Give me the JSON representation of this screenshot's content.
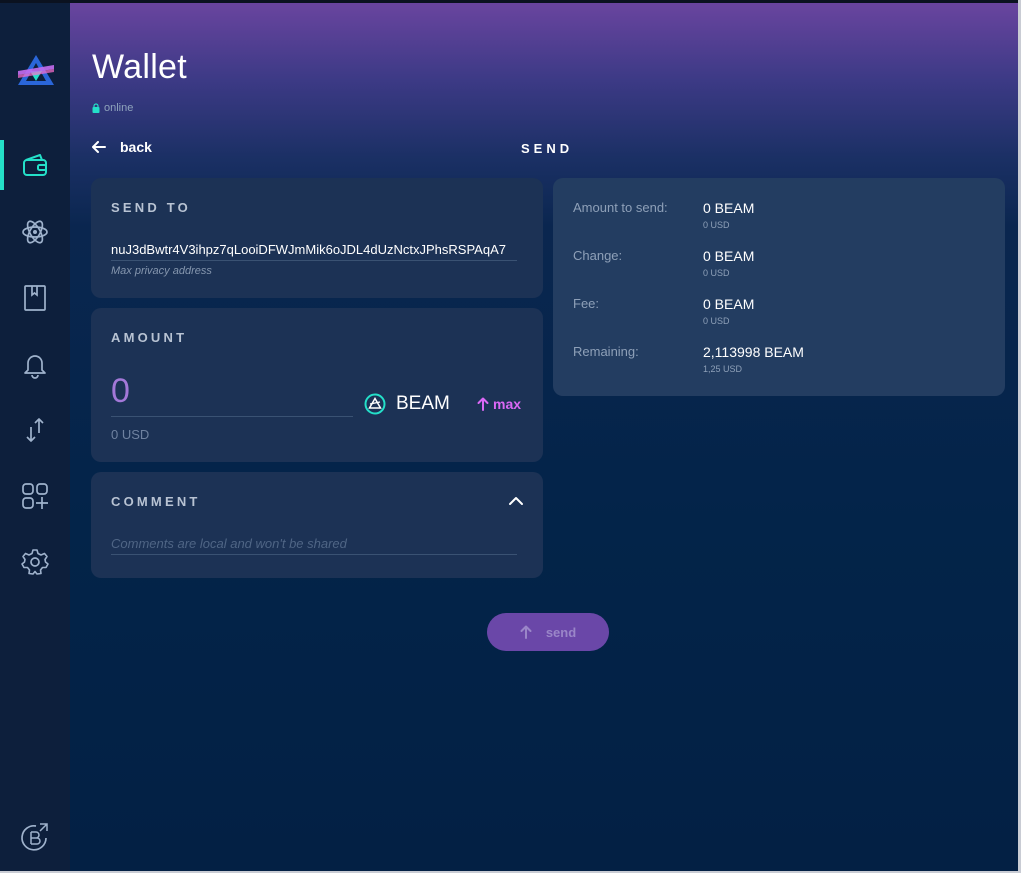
{
  "header": {
    "title": "Wallet",
    "status": "online",
    "back_label": "back",
    "section": "SEND"
  },
  "sidebar": {
    "items": [
      {
        "icon": "wallet-icon"
      },
      {
        "icon": "atom-icon"
      },
      {
        "icon": "address-book-icon"
      },
      {
        "icon": "bell-icon"
      },
      {
        "icon": "swap-icon"
      },
      {
        "icon": "apps-icon"
      },
      {
        "icon": "settings-icon"
      },
      {
        "icon": "explorer-icon"
      }
    ]
  },
  "send_to": {
    "title": "SEND TO",
    "address": "nuJ3dBwtr4V3ihpz7qLooiDFWJmMik6oJDL4dUzNctxJPhsRSPAqA7",
    "hint": "Max privacy address"
  },
  "amount": {
    "title": "AMOUNT",
    "value": "0",
    "usd": "0 USD",
    "currency": "BEAM",
    "max_label": "max"
  },
  "comment": {
    "title": "COMMENT",
    "placeholder": "Comments are local and won't be shared"
  },
  "summary": {
    "rows": [
      {
        "label": "Amount to send:",
        "value": "0  BEAM",
        "usd": "0 USD"
      },
      {
        "label": "Change:",
        "value": "0  BEAM",
        "usd": "0 USD"
      },
      {
        "label": "Fee:",
        "value": "0  BEAM",
        "usd": "0 USD"
      },
      {
        "label": "Remaining:",
        "value": "2,113998  BEAM",
        "usd": "1,25 USD"
      }
    ]
  },
  "send_button": {
    "label": "send"
  },
  "colors": {
    "accent": "#24e0c9",
    "max": "#da68f5",
    "button": "#6a47a8",
    "panel": "#1c3255"
  }
}
